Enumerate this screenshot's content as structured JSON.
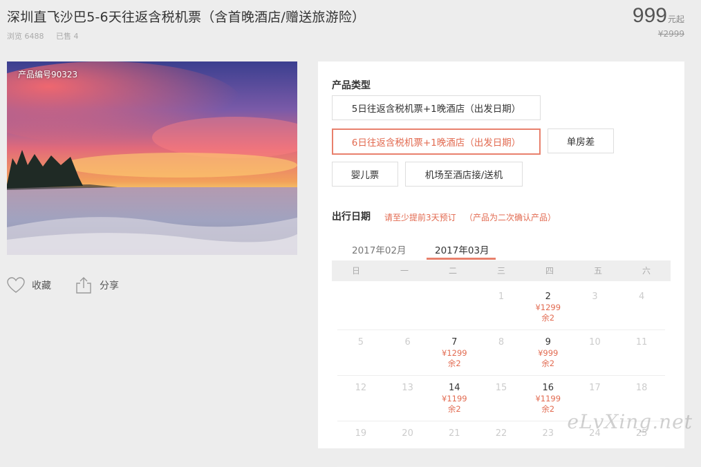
{
  "header": {
    "title": "深圳直飞沙巴5-6天往返含税机票（含首晚酒店/赠送旅游险）",
    "views": "浏览 6488",
    "sold": "已售 4",
    "price": "999",
    "price_unit": "元起",
    "original_price": "¥2999"
  },
  "photo": {
    "label": "产品编号90323"
  },
  "actions": {
    "favorite": "收藏",
    "share": "分享"
  },
  "product_types": {
    "title": "产品类型",
    "options": [
      "5日往返含税机票+1晚酒店（出发日期）",
      "6日往返含税机票+1晚酒店（出发日期）",
      "单房差",
      "婴儿票",
      "机场至酒店接/送机"
    ],
    "selected": "6日往返含税机票+1晚酒店（出发日期）"
  },
  "travel_date": {
    "title": "出行日期",
    "note1": "请至少提前3天预订",
    "note2": "（产品为二次确认产品）"
  },
  "calendar": {
    "months": [
      "2017年02月",
      "2017年03月"
    ],
    "active_month": "2017年03月",
    "weekdays": [
      "日",
      "一",
      "二",
      "三",
      "四",
      "五",
      "六"
    ],
    "weeks": [
      [
        {
          "d": ""
        },
        {
          "d": ""
        },
        {
          "d": ""
        },
        {
          "d": "1"
        },
        {
          "d": "2",
          "price": "¥1299",
          "left": "余2"
        },
        {
          "d": "3"
        },
        {
          "d": "4"
        }
      ],
      [
        {
          "d": "5"
        },
        {
          "d": "6"
        },
        {
          "d": "7",
          "price": "¥1299",
          "left": "余2"
        },
        {
          "d": "8"
        },
        {
          "d": "9",
          "price": "¥999",
          "left": "余2"
        },
        {
          "d": "10"
        },
        {
          "d": "11"
        }
      ],
      [
        {
          "d": "12"
        },
        {
          "d": "13"
        },
        {
          "d": "14",
          "price": "¥1199",
          "left": "余2"
        },
        {
          "d": "15"
        },
        {
          "d": "16",
          "price": "¥1199",
          "left": "余2"
        },
        {
          "d": "17"
        },
        {
          "d": "18"
        }
      ],
      [
        {
          "d": "19"
        },
        {
          "d": "20"
        },
        {
          "d": "21"
        },
        {
          "d": "22"
        },
        {
          "d": "23"
        },
        {
          "d": "24"
        },
        {
          "d": "25"
        }
      ]
    ]
  },
  "watermark": "eLvXing.net",
  "colors": {
    "accent": "#e26a50",
    "accent_border": "#e8806c",
    "background": "#ededed"
  }
}
